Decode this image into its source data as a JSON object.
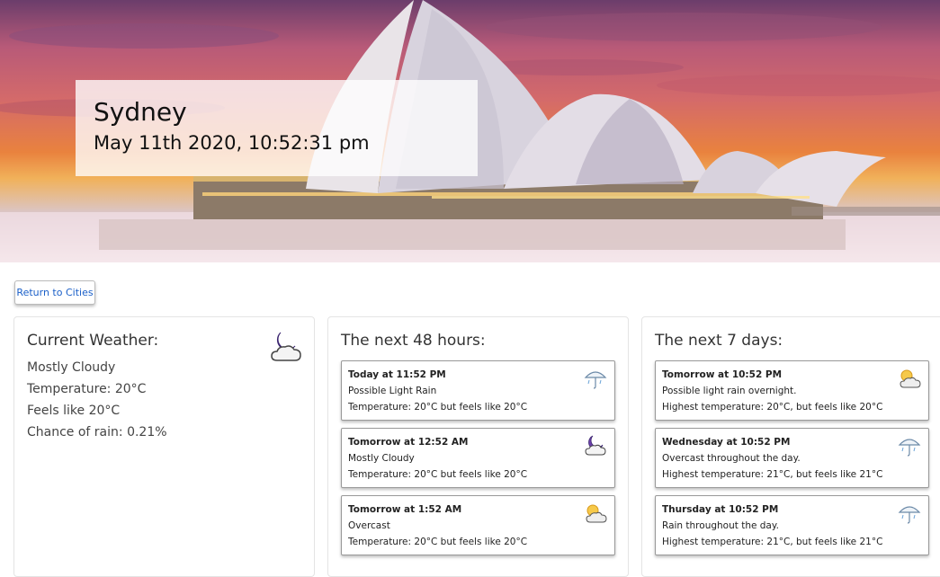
{
  "header": {
    "city": "Sydney",
    "datetime": "May 11th 2020, 10:52:31 pm"
  },
  "nav": {
    "back_label": "Return to Cities"
  },
  "current": {
    "title": "Current Weather:",
    "summary": "Mostly Cloudy",
    "temperature": "Temperature: 20°C",
    "feels_like": "Feels like 20°C",
    "rain": "Chance of rain: 0.21%",
    "icon": "partly-cloudy-night-icon"
  },
  "hourly": {
    "title": "The next 48 hours:",
    "items": [
      {
        "time": "Today at 11:52 PM",
        "summary": "Possible Light Rain",
        "temp": "Temperature: 20°C but feels like 20°C",
        "icon": "umbrella-rain-icon"
      },
      {
        "time": "Tomorrow at 12:52 AM",
        "summary": "Mostly Cloudy",
        "temp": "Temperature: 20°C but feels like 20°C",
        "icon": "partly-cloudy-night-icon"
      },
      {
        "time": "Tomorrow at 1:52 AM",
        "summary": "Overcast",
        "temp": "Temperature: 20°C but feels like 20°C",
        "icon": "sun-cloud-icon"
      }
    ]
  },
  "daily": {
    "title": "The next 7 days:",
    "items": [
      {
        "time": "Tomorrow at 10:52 PM",
        "summary": "Possible light rain overnight.",
        "temp": "Highest temperature: 20°C, but feels like 20°C",
        "icon": "sun-cloud-icon"
      },
      {
        "time": "Wednesday at 10:52 PM",
        "summary": "Overcast throughout the day.",
        "temp": "Highest temperature: 21°C, but feels like 21°C",
        "icon": "umbrella-rain-icon"
      },
      {
        "time": "Thursday at 10:52 PM",
        "summary": "Rain throughout the day.",
        "temp": "Highest temperature: 21°C, but feels like 21°C",
        "icon": "umbrella-rain-icon"
      }
    ]
  },
  "colors": {
    "link": "#1a5fc8",
    "sky_top": "#6b3d6b",
    "sky_mid": "#d46a6a",
    "sky_low": "#f1b15a"
  }
}
